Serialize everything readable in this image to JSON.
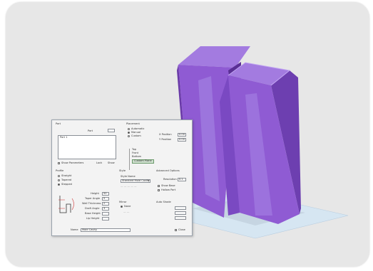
{
  "colors": {
    "page_background": "#ffffff",
    "card_background": "#e7e7e7",
    "model_purple": "#8f5bd3",
    "model_purple_dark": "#6a3aa8",
    "platform_blue": "#d6e6f2",
    "dialog_background": "#f3f3f3"
  },
  "dialog": {
    "section_part": "Part",
    "part_label": "Part",
    "part_value": "Part 1",
    "show_parameters_label": "Show Parameters",
    "lock_label": "Lock",
    "show_label": "Show",
    "section_placement": "Placement",
    "placement_options": [
      "Automatic",
      "Manual",
      "Custom"
    ],
    "placement_right_labels": [
      "X Position",
      "Y Position"
    ],
    "placement_right_values": [
      "0.00",
      "0.00"
    ],
    "tree_items": [
      "Top",
      "Front",
      "Bottom",
      "Custom Plane"
    ],
    "section_profile": "Profile",
    "profile_options": [
      "Straight",
      "Tapered",
      "Stepped"
    ],
    "dimension_labels": [
      "Height",
      "Taper Angle",
      "Wall Thickness",
      "Draft Angle",
      "Base Height",
      "Lip Height"
    ],
    "dimension_values": [
      "50",
      "5",
      "2",
      "3",
      "",
      ""
    ],
    "section_style": "Style",
    "style_label": "Style Name",
    "style_value": "Standard Mold Cavity",
    "section_advanced": "Advanced Options",
    "advanced_label": "Resolution",
    "advanced_value": "0.1",
    "advanced_checks": [
      "Show Base",
      "Hollow Part"
    ],
    "section_mirror": "Mirror",
    "mirror_options": [
      "None"
    ],
    "section_auto_shade": "Auto Shade",
    "auto_shade_values": [
      "",
      "",
      ""
    ],
    "name_label": "Name",
    "name_value": "Mold Cavity",
    "close_label": "Close"
  }
}
